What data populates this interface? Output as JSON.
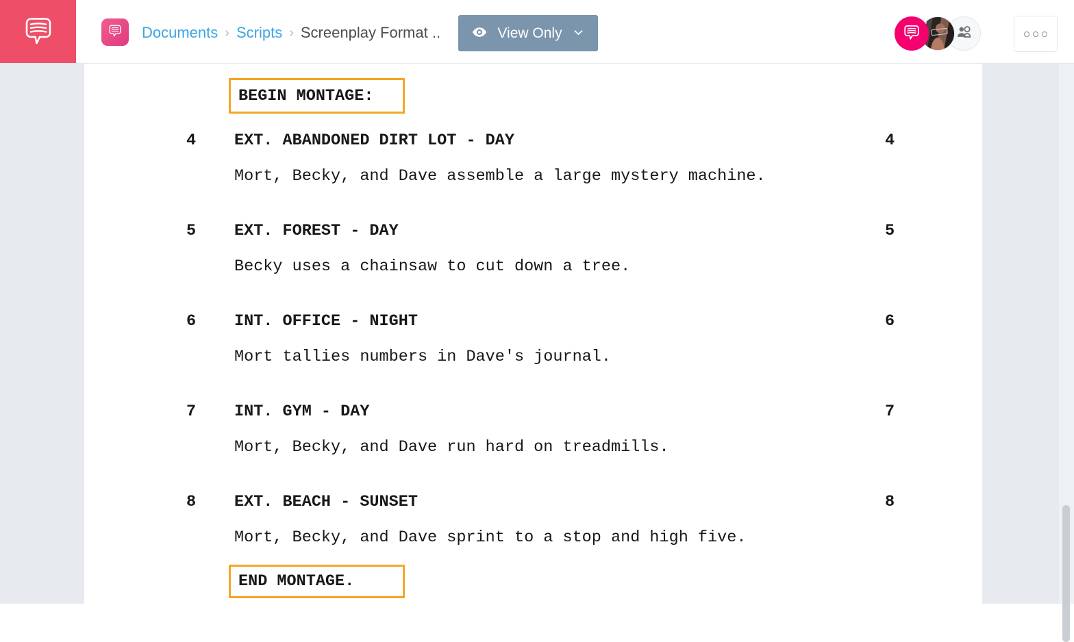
{
  "app": {
    "logo_icon": "chat-bubble-lines-icon",
    "brand_color": "#ef4e68"
  },
  "header": {
    "doc_icon": "chat-bubble-document-icon",
    "breadcrumb": {
      "items": [
        {
          "label": "Documents",
          "type": "link"
        },
        {
          "label": "Scripts",
          "type": "link"
        },
        {
          "label": "Screenplay Format ..",
          "type": "current"
        }
      ],
      "separator": "›"
    },
    "view_mode_button": {
      "label": "View Only",
      "icon": "eye-icon",
      "chevron": "chevron-down-icon",
      "color": "#7b95ad"
    },
    "collaborators": [
      {
        "name": "chat-avatar",
        "type": "icon",
        "color": "#f5006e"
      },
      {
        "name": "user-photo-avatar",
        "type": "photo"
      },
      {
        "name": "add-people-avatar",
        "type": "icon"
      }
    ],
    "more_button": {
      "label": "○○○",
      "icon": "three-dots-icon"
    }
  },
  "document": {
    "page_background": "#ffffff",
    "workspace_background": "#e7ebef",
    "marker_color": "#f5a623",
    "montage_begin": "BEGIN MONTAGE:",
    "montage_end": "END MONTAGE.",
    "scenes": [
      {
        "number": "4",
        "heading": "EXT. ABANDONED DIRT LOT - DAY",
        "action": "Mort, Becky, and Dave assemble a large mystery machine."
      },
      {
        "number": "5",
        "heading": "EXT. FOREST - DAY",
        "action": "Becky uses a chainsaw to cut down a tree."
      },
      {
        "number": "6",
        "heading": "INT. OFFICE - NIGHT",
        "action": "Mort tallies numbers in Dave's journal."
      },
      {
        "number": "7",
        "heading": "INT. GYM - DAY",
        "action": "Mort, Becky, and Dave run hard on treadmills."
      },
      {
        "number": "8",
        "heading": "EXT. BEACH - SUNSET",
        "action": "Mort, Becky, and Dave sprint to a stop and high five."
      }
    ]
  }
}
